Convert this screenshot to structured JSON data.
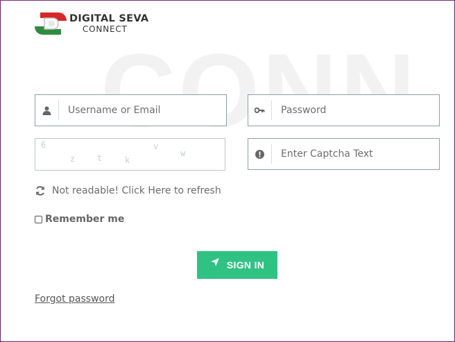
{
  "brand": {
    "title": "DIGITAL SEVA",
    "subtitle": "CONNECT",
    "watermark": "CONN",
    "colors": {
      "green": "#2e8b3e",
      "red": "#d62828"
    }
  },
  "form": {
    "username": {
      "placeholder": "Username or Email",
      "value": "",
      "icon": "user-icon"
    },
    "password": {
      "placeholder": "Password",
      "value": "",
      "icon": "key-icon"
    },
    "captcha": {
      "chars": [
        "6",
        "z",
        "t",
        "k",
        "v",
        "w"
      ],
      "input_placeholder": "Enter Captcha Text",
      "input_value": "",
      "icon": "exclamation-icon"
    },
    "refresh_label": "Not readable! Click Here to refresh",
    "remember_label": "Remember me",
    "remember_checked": false,
    "signin_label": "SIGN IN",
    "forgot_label": "Forgot password"
  },
  "colors": {
    "signin_bg": "#2fc283",
    "field_border": "#8aa0a8"
  }
}
